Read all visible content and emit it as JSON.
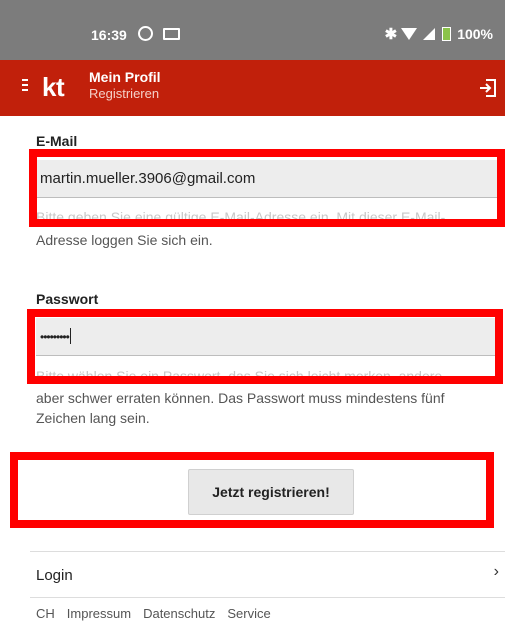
{
  "status_bar": {
    "time": "16:39",
    "battery": "100%",
    "icons": [
      "alarm-icon",
      "cast-icon",
      "bluetooth-icon",
      "wifi-icon",
      "signal-icon",
      "battery-icon"
    ]
  },
  "app_bar": {
    "logo": "kt",
    "title": "Mein Profil",
    "subtitle": "Registrieren",
    "icons": [
      "menu-icon",
      "logout-icon"
    ],
    "color": "#c1200b"
  },
  "form": {
    "email": {
      "label": "E-Mail",
      "value": "martin.mueller.3906@gmail.com",
      "hint_obscured": "Bitte geben Sie eine gültige E-Mail-Adresse ein. Mit dieser E-Mail-",
      "hint_visible": "Adresse loggen Sie sich ein."
    },
    "password": {
      "label": "Passwort",
      "value": "•••••••••",
      "hint_obscured": "Bitte wählen Sie ein Passwort, das Sie sich leicht merken, andere",
      "hint_visible_1": "aber schwer erraten können. Das Passwort muss mindestens fünf",
      "hint_visible_2": "Zeichen lang sein."
    },
    "submit_label": "Jetzt registrieren!"
  },
  "menu": {
    "login_label": "Login"
  },
  "footer": {
    "links": [
      "CH",
      "Impressum",
      "Datenschutz",
      "Service"
    ]
  },
  "highlight_color": "#ff0000"
}
